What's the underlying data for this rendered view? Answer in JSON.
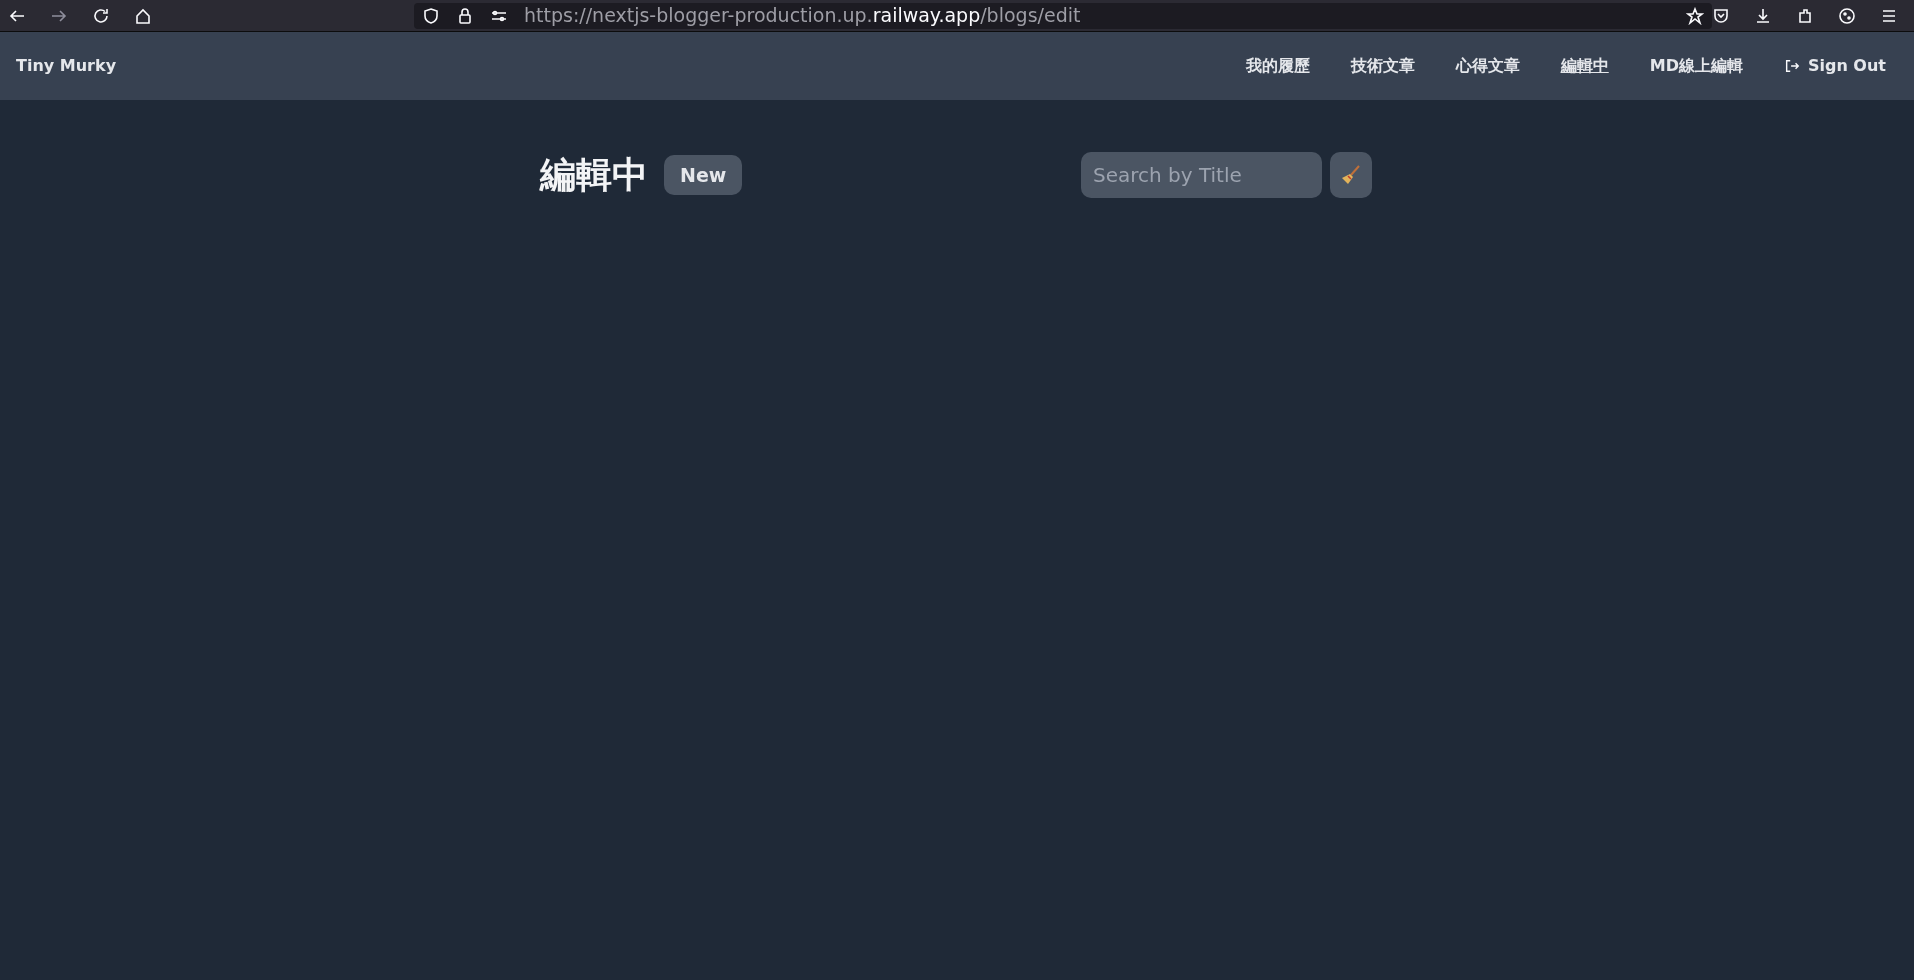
{
  "browser": {
    "url_prefix": "https://nextjs-blogger-production.up.",
    "url_domain": "railway.app",
    "url_suffix": "/blogs/edit"
  },
  "navbar": {
    "brand": "Tiny Murky",
    "links": [
      {
        "label": "我的履歷",
        "selected": false
      },
      {
        "label": "技術文章",
        "selected": false
      },
      {
        "label": "心得文章",
        "selected": false
      },
      {
        "label": "編輯中",
        "selected": true
      },
      {
        "label": "MD線上編輯",
        "selected": false
      }
    ],
    "sign_out": "Sign Out"
  },
  "page": {
    "title": "編輯中",
    "new_button": "New",
    "search": {
      "placeholder": "Search by Title"
    }
  }
}
